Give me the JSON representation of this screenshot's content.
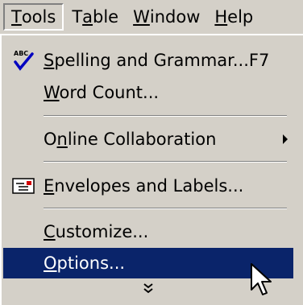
{
  "menubar": {
    "items": [
      {
        "pre": "",
        "key": "T",
        "post": "ools"
      },
      {
        "pre": "T",
        "key": "a",
        "post": "ble"
      },
      {
        "pre": "",
        "key": "W",
        "post": "indow"
      },
      {
        "pre": "",
        "key": "H",
        "post": "elp"
      }
    ]
  },
  "menu": {
    "spelling": {
      "pre": "",
      "key": "S",
      "post": "pelling and Grammar...",
      "shortcut": "F7",
      "icon_text": "ABC"
    },
    "wordcount": {
      "pre": "",
      "key": "W",
      "post": "ord Count..."
    },
    "online": {
      "pre": "O",
      "key": "n",
      "post": "line Collaboration"
    },
    "envelopes": {
      "pre": "",
      "key": "E",
      "post": "nvelopes and Labels..."
    },
    "customize": {
      "pre": "",
      "key": "C",
      "post": "ustomize..."
    },
    "options": {
      "pre": "",
      "key": "O",
      "post": "ptions..."
    }
  },
  "colors": {
    "menu_bg": "#d4d0c8",
    "highlight_bg": "#0a246a",
    "highlight_fg": "#ffffff"
  }
}
